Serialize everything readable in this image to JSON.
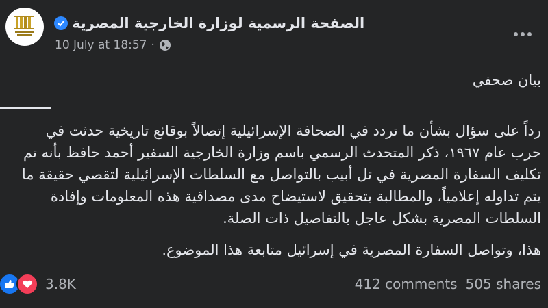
{
  "post": {
    "page_name": "الصفحة الرسمية لوزارة الخارجية المصرية",
    "timestamp": "10 July at 18:57",
    "separator": "·",
    "heading": "بيان صحفي",
    "lines": [
      "رداً على سؤال بشأن ما تردد في الصحافة الإسرائيلية إتصالاً بوقائع تاريخية حدثت في",
      "حرب عام ١٩٦٧، ذكر المتحدث الرسمي باسم وزارة الخارجية السفير أحمد حافظ بأنه تم",
      "تكليف السفارة المصرية في تل أبيب بالتواصل مع السلطات الإسرائيلية لتقصي حقيقة ما",
      "يتم تداوله إعلامياً، والمطالبة بتحقيق لاستيضاح مدى مصداقية هذه المعلومات وإفادة",
      "السلطات المصرية بشكل عاجل بالتفاصيل ذات الصلة.",
      "هذا، وتواصل السفارة المصرية في إسرائيل متابعة هذا الموضوع."
    ]
  },
  "footer": {
    "reaction_count": "3.8K",
    "comments": "412 comments",
    "shares": "505 shares"
  },
  "icons": {
    "verified": "verified-badge-icon",
    "audience": "globe-icon",
    "more": "more-options-icon",
    "like": "like-reaction-icon",
    "love": "love-reaction-icon"
  },
  "colors": {
    "background": "#242526",
    "text": "#e4e6eb",
    "secondary": "#b0b3b8",
    "verified": "#2d88ff",
    "like": "#1877f2",
    "love": "#f33e58"
  }
}
